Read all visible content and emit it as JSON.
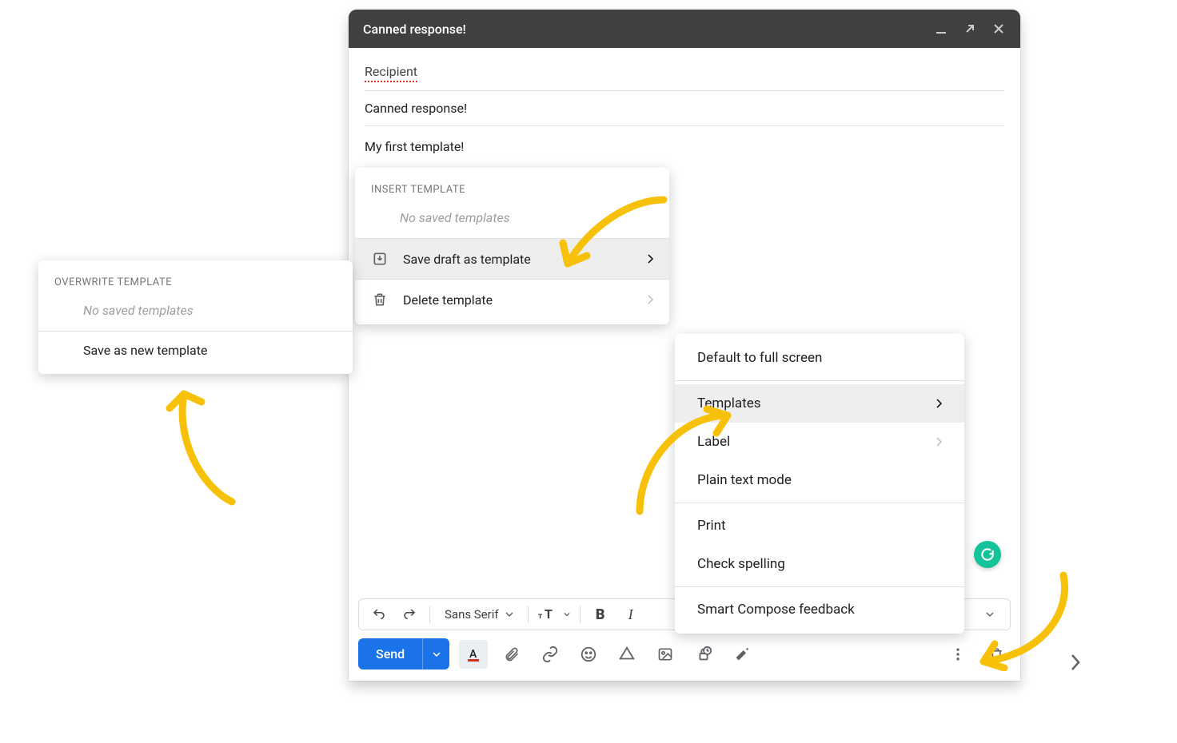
{
  "compose": {
    "title": "Canned response!",
    "recipient_label": "Recipient",
    "subject": "Canned response!",
    "body": "My first template!",
    "font_name": "Sans Serif",
    "send_label": "Send"
  },
  "more_menu": {
    "full_screen": "Default to full screen",
    "templates": "Templates",
    "label": "Label",
    "plain_text": "Plain text mode",
    "print": "Print",
    "check_spelling": "Check spelling",
    "smart_compose": "Smart Compose feedback"
  },
  "templates_menu": {
    "section": "Insert template",
    "empty": "No saved templates",
    "save_draft": "Save draft as template",
    "delete": "Delete template"
  },
  "overwrite_menu": {
    "section": "Overwrite Template",
    "empty": "No saved templates",
    "save_new": "Save as new template"
  }
}
